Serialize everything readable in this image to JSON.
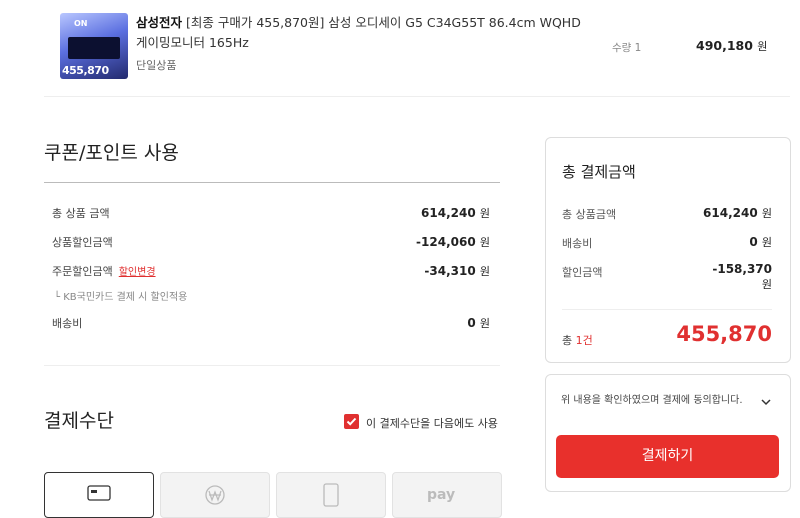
{
  "product": {
    "image_badge": "ON",
    "image_price": "455,870",
    "brand": "삼성전자",
    "title": "[최종 구매가 455,870원] 삼성 오디세이 G5 C34G55T 86.4cm WQHD 게이밍모니터 165Hz",
    "option": "단일상품",
    "qty_label": "수량 1",
    "price": "490,180",
    "won": "원"
  },
  "coupon": {
    "heading": "쿠폰/포인트 사용",
    "rows": [
      {
        "label": "총 상품 금액",
        "value": "614,240"
      },
      {
        "label": "상품할인금액",
        "value": "-124,060"
      },
      {
        "label": "주문할인금액",
        "value": "-34,310",
        "link": "할인변경"
      },
      {
        "label": "배송비",
        "value": "0"
      }
    ],
    "note": "└ KB국민카드 결제 시 할인적용",
    "won": "원"
  },
  "payment": {
    "heading": "결제수단",
    "reuse_label": "이 결제수단을 다음에도 사용",
    "reuse_checked": true,
    "methods": [
      "card-icon",
      "won-icon",
      "phone-icon",
      "pay-icon"
    ],
    "pay_text": "pay"
  },
  "summary": {
    "title": "총 결제금액",
    "rows": [
      {
        "label": "총 상품금액",
        "value": "614,240",
        "unit": "원"
      },
      {
        "label": "배송비",
        "value": "0",
        "unit": "원"
      },
      {
        "label": "할인금액",
        "value": "-158,370",
        "unit": "원"
      }
    ],
    "count_prefix": "총 ",
    "count": "1건",
    "total": "455,870"
  },
  "agree": {
    "text": "위 내용을 확인하였으며 결제에 동의합니다.",
    "button": "결제하기"
  },
  "colors": {
    "accent": "#e8302c"
  }
}
